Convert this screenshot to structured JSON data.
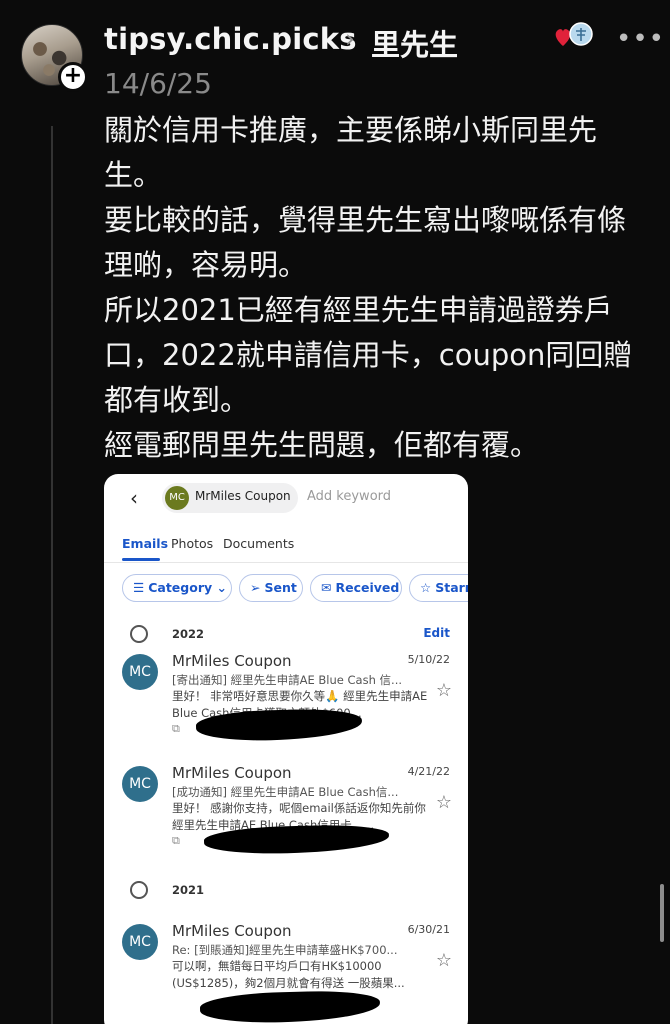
{
  "post": {
    "username": "tipsy.chic.picks",
    "topic": "里先生",
    "date": "14/6/25",
    "add_icon": "plus-icon",
    "more_icon": "more-dots-icon",
    "paragraphs": [
      "關於信用卡推廣，主要係睇小斯同里先生。",
      "要比較的話，覺得里先生寫出嚟嘅係有條理啲，容易明。",
      "所以2021已經有經里先生申請過證券戶口，2022就申請信用卡，coupon同回贈都有收到。",
      "經電郵問里先生問題，佢都有覆。"
    ]
  },
  "screenshot": {
    "back_icon": "chevron-left-icon",
    "chip_avatar": "MC",
    "chip_name": "MrMiles Coupon",
    "search_placeholder": "Add keyword",
    "tabs": [
      "Emails",
      "Photos",
      "Documents"
    ],
    "filters": [
      {
        "icon": "☰",
        "label": "Category ⌄"
      },
      {
        "icon": "➢",
        "label": "Sent"
      },
      {
        "icon": "✉",
        "label": "Received"
      },
      {
        "icon": "☆",
        "label": "Starre"
      }
    ],
    "sections": [
      {
        "year": "2022",
        "action": "Edit",
        "mails": [
          {
            "avatar": "MC",
            "sender": "MrMiles Coupon",
            "date": "5/10/22",
            "subject": "[寄出通知] 經里先生申請AE Blue Cash 信...",
            "preview": "里好！ 非常唔好意思要你久等🙏 經里先生申請AE Blue Cash信用卡獲取之額外$600..."
          },
          {
            "avatar": "MC",
            "sender": "MrMiles Coupon",
            "date": "4/21/22",
            "subject": "[成功通知] 經里先生申請AE Blue Cash信...",
            "preview": "里好！ 感謝你支持，呢個email係話返你知先前你經里先生申請AE Blue Cash信用卡，..."
          }
        ]
      },
      {
        "year": "2021",
        "action": "",
        "mails": [
          {
            "avatar": "MC",
            "sender": "MrMiles Coupon",
            "date": "6/30/21",
            "subject": "Re: [到賬通知]經里先生申請華盛HK$700...",
            "preview": "可以啊，無錯每日平均戶口有HK$10000 (US$1285)，夠2個月就會有得送 一股蘋果..."
          }
        ]
      }
    ]
  }
}
